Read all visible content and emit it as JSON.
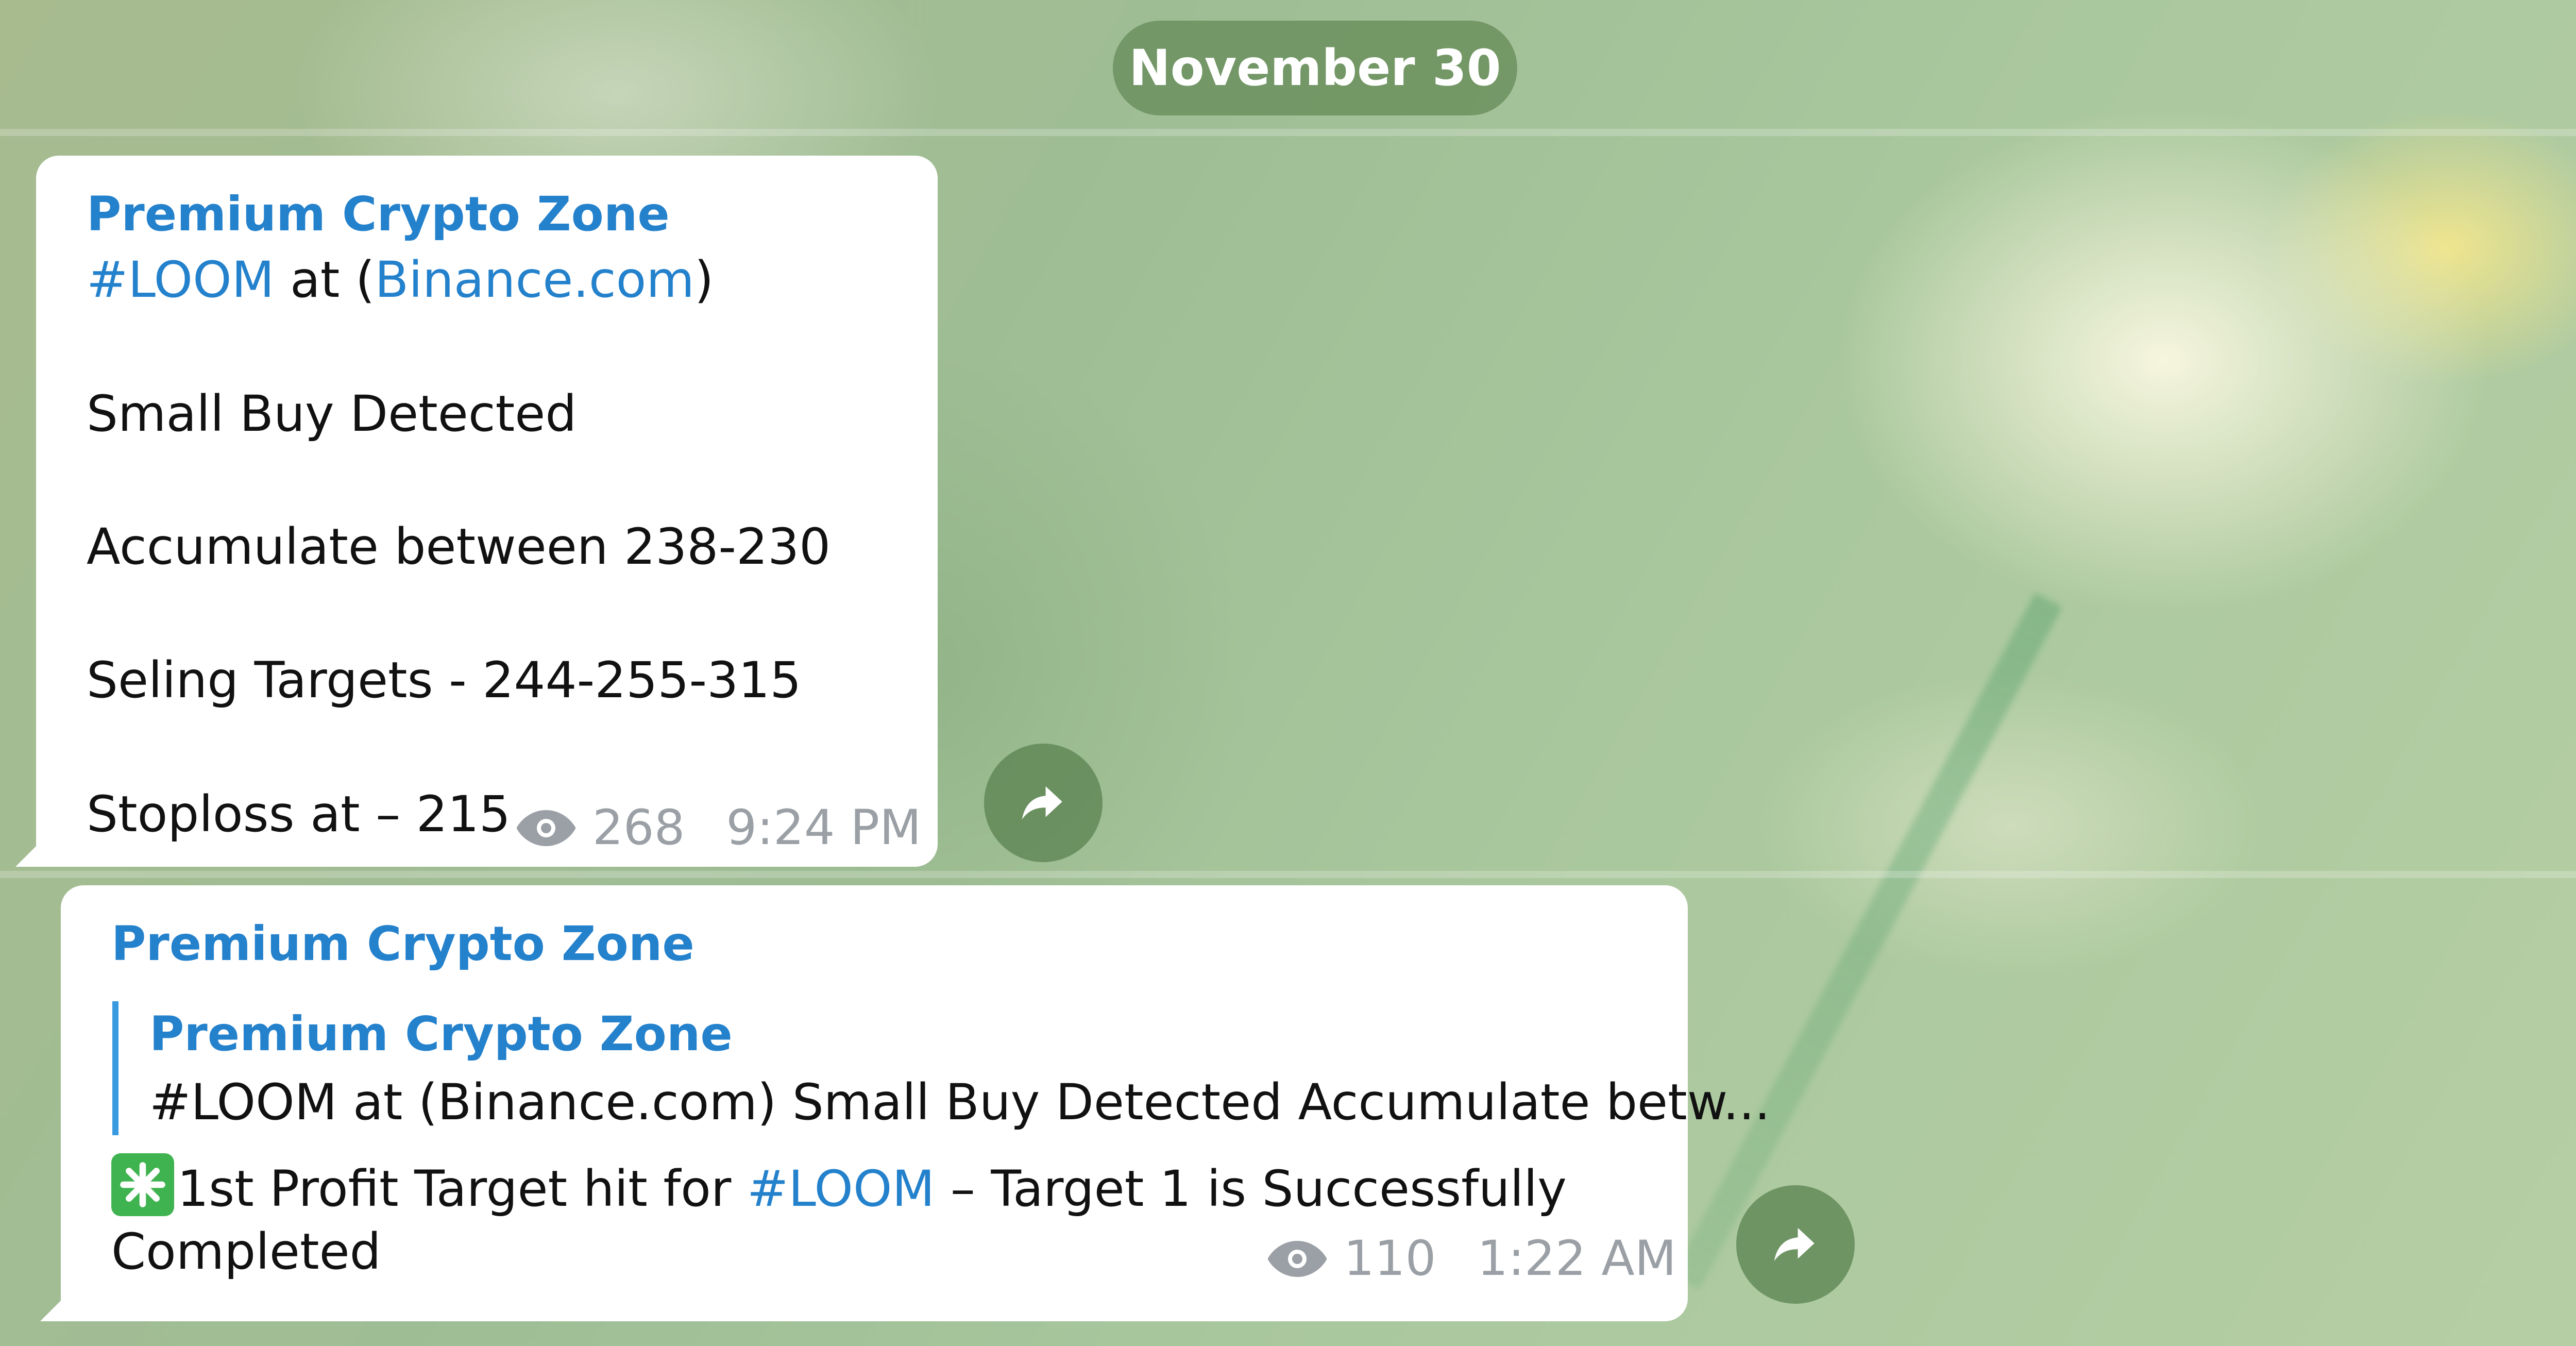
{
  "date_separator": "November 30",
  "messages": [
    {
      "sender": "Premium Crypto Zone",
      "hashtag": "#LOOM",
      "at_text": " at (",
      "link_text": "Binance.com",
      "close_paren": ")",
      "lines": [
        "Small Buy Detected",
        "Accumulate between 238-230",
        "Seling Targets - 244-255-315",
        "Stoploss at – 215"
      ],
      "views": "268",
      "time": "9:24 PM"
    },
    {
      "sender": "Premium Crypto Zone",
      "reply": {
        "sender": "Premium Crypto Zone",
        "text": "#LOOM at (Binance.com)  Small Buy Detected  Accumulate betw..."
      },
      "text_before": "1st Profit Target hit for ",
      "hashtag": "#LOOM",
      "text_after": " – Target 1 is Successfully",
      "text_line2": "Completed",
      "views": "110",
      "time": "1:22 AM"
    }
  ],
  "icons": {
    "share": "share-arrow-icon",
    "views": "eye-icon",
    "emoji": "eight-spoked-asterisk-emoji"
  },
  "colors": {
    "link": "#2481cc",
    "date_pill": "#668c58",
    "emoji_green": "#3fb34f"
  }
}
